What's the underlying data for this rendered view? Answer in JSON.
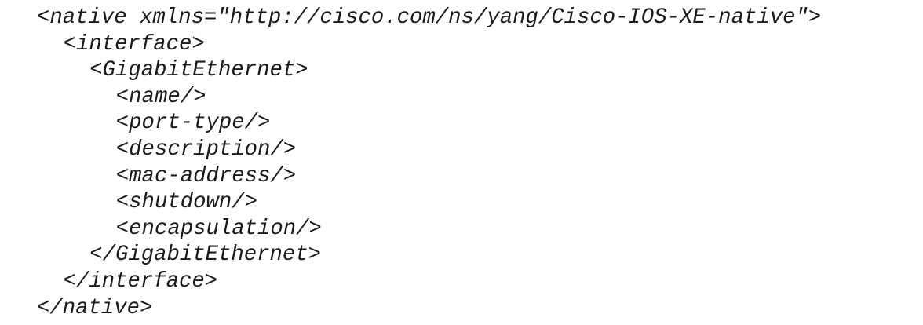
{
  "code": {
    "lines": [
      "<native xmlns=\"http://cisco.com/ns/yang/Cisco-IOS-XE-native\">",
      "<interface>",
      "<GigabitEthernet>",
      "<name/>",
      "<port-type/>",
      "<description/>",
      "<mac-address/>",
      "<shutdown/>",
      "<encapsulation/>",
      "</GigabitEthernet>",
      "</interface>",
      "</native>"
    ]
  }
}
